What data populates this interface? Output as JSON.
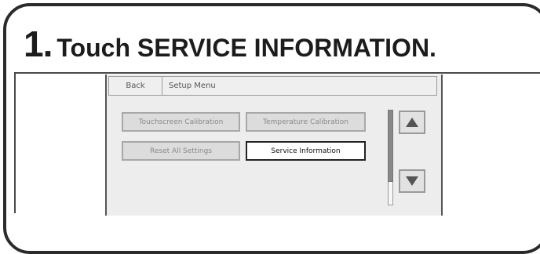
{
  "step": {
    "number": "1.",
    "text": "Touch SERVICE INFORMATION."
  },
  "topbar": {
    "back_label": "Back",
    "title": "Setup Menu"
  },
  "menu": {
    "buttons": [
      {
        "label": "Touchscreen Calibration",
        "state": "disabled"
      },
      {
        "label": "Temperature Calibration",
        "state": "disabled"
      },
      {
        "label": "Reset All Settings",
        "state": "disabled"
      },
      {
        "label": "Service Information",
        "state": "active"
      }
    ]
  },
  "icons": {
    "up": "triangle-up-icon",
    "down": "triangle-down-icon"
  },
  "colors": {
    "frame": "#2b2b2b",
    "screen_bg": "#ededed",
    "disabled_btn": "#dcdcdc",
    "active_border": "#222222"
  }
}
